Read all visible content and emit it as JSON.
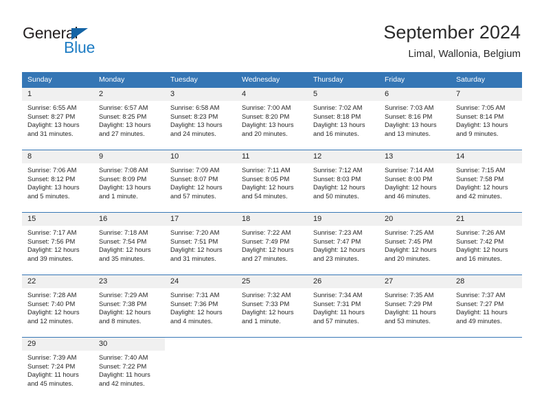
{
  "logo": {
    "word_one": "General",
    "word_two": "Blue",
    "triangle_color": "#1464a5",
    "blue_color": "#1f7dc4"
  },
  "header": {
    "title": "September 2024",
    "subtitle": "Limal, Wallonia, Belgium"
  },
  "theme": {
    "header_blue": "#3576b5",
    "daynum_gray": "#f0f0f0",
    "text_color": "#262626"
  },
  "calendar": {
    "weekdays": [
      "Sunday",
      "Monday",
      "Tuesday",
      "Wednesday",
      "Thursday",
      "Friday",
      "Saturday"
    ],
    "weeks": [
      [
        {
          "day": "1",
          "sunrise": "Sunrise: 6:55 AM",
          "sunset": "Sunset: 8:27 PM",
          "daylight_1": "Daylight: 13 hours",
          "daylight_2": "and 31 minutes."
        },
        {
          "day": "2",
          "sunrise": "Sunrise: 6:57 AM",
          "sunset": "Sunset: 8:25 PM",
          "daylight_1": "Daylight: 13 hours",
          "daylight_2": "and 27 minutes."
        },
        {
          "day": "3",
          "sunrise": "Sunrise: 6:58 AM",
          "sunset": "Sunset: 8:23 PM",
          "daylight_1": "Daylight: 13 hours",
          "daylight_2": "and 24 minutes."
        },
        {
          "day": "4",
          "sunrise": "Sunrise: 7:00 AM",
          "sunset": "Sunset: 8:20 PM",
          "daylight_1": "Daylight: 13 hours",
          "daylight_2": "and 20 minutes."
        },
        {
          "day": "5",
          "sunrise": "Sunrise: 7:02 AM",
          "sunset": "Sunset: 8:18 PM",
          "daylight_1": "Daylight: 13 hours",
          "daylight_2": "and 16 minutes."
        },
        {
          "day": "6",
          "sunrise": "Sunrise: 7:03 AM",
          "sunset": "Sunset: 8:16 PM",
          "daylight_1": "Daylight: 13 hours",
          "daylight_2": "and 13 minutes."
        },
        {
          "day": "7",
          "sunrise": "Sunrise: 7:05 AM",
          "sunset": "Sunset: 8:14 PM",
          "daylight_1": "Daylight: 13 hours",
          "daylight_2": "and 9 minutes."
        }
      ],
      [
        {
          "day": "8",
          "sunrise": "Sunrise: 7:06 AM",
          "sunset": "Sunset: 8:12 PM",
          "daylight_1": "Daylight: 13 hours",
          "daylight_2": "and 5 minutes."
        },
        {
          "day": "9",
          "sunrise": "Sunrise: 7:08 AM",
          "sunset": "Sunset: 8:09 PM",
          "daylight_1": "Daylight: 13 hours",
          "daylight_2": "and 1 minute."
        },
        {
          "day": "10",
          "sunrise": "Sunrise: 7:09 AM",
          "sunset": "Sunset: 8:07 PM",
          "daylight_1": "Daylight: 12 hours",
          "daylight_2": "and 57 minutes."
        },
        {
          "day": "11",
          "sunrise": "Sunrise: 7:11 AM",
          "sunset": "Sunset: 8:05 PM",
          "daylight_1": "Daylight: 12 hours",
          "daylight_2": "and 54 minutes."
        },
        {
          "day": "12",
          "sunrise": "Sunrise: 7:12 AM",
          "sunset": "Sunset: 8:03 PM",
          "daylight_1": "Daylight: 12 hours",
          "daylight_2": "and 50 minutes."
        },
        {
          "day": "13",
          "sunrise": "Sunrise: 7:14 AM",
          "sunset": "Sunset: 8:00 PM",
          "daylight_1": "Daylight: 12 hours",
          "daylight_2": "and 46 minutes."
        },
        {
          "day": "14",
          "sunrise": "Sunrise: 7:15 AM",
          "sunset": "Sunset: 7:58 PM",
          "daylight_1": "Daylight: 12 hours",
          "daylight_2": "and 42 minutes."
        }
      ],
      [
        {
          "day": "15",
          "sunrise": "Sunrise: 7:17 AM",
          "sunset": "Sunset: 7:56 PM",
          "daylight_1": "Daylight: 12 hours",
          "daylight_2": "and 39 minutes."
        },
        {
          "day": "16",
          "sunrise": "Sunrise: 7:18 AM",
          "sunset": "Sunset: 7:54 PM",
          "daylight_1": "Daylight: 12 hours",
          "daylight_2": "and 35 minutes."
        },
        {
          "day": "17",
          "sunrise": "Sunrise: 7:20 AM",
          "sunset": "Sunset: 7:51 PM",
          "daylight_1": "Daylight: 12 hours",
          "daylight_2": "and 31 minutes."
        },
        {
          "day": "18",
          "sunrise": "Sunrise: 7:22 AM",
          "sunset": "Sunset: 7:49 PM",
          "daylight_1": "Daylight: 12 hours",
          "daylight_2": "and 27 minutes."
        },
        {
          "day": "19",
          "sunrise": "Sunrise: 7:23 AM",
          "sunset": "Sunset: 7:47 PM",
          "daylight_1": "Daylight: 12 hours",
          "daylight_2": "and 23 minutes."
        },
        {
          "day": "20",
          "sunrise": "Sunrise: 7:25 AM",
          "sunset": "Sunset: 7:45 PM",
          "daylight_1": "Daylight: 12 hours",
          "daylight_2": "and 20 minutes."
        },
        {
          "day": "21",
          "sunrise": "Sunrise: 7:26 AM",
          "sunset": "Sunset: 7:42 PM",
          "daylight_1": "Daylight: 12 hours",
          "daylight_2": "and 16 minutes."
        }
      ],
      [
        {
          "day": "22",
          "sunrise": "Sunrise: 7:28 AM",
          "sunset": "Sunset: 7:40 PM",
          "daylight_1": "Daylight: 12 hours",
          "daylight_2": "and 12 minutes."
        },
        {
          "day": "23",
          "sunrise": "Sunrise: 7:29 AM",
          "sunset": "Sunset: 7:38 PM",
          "daylight_1": "Daylight: 12 hours",
          "daylight_2": "and 8 minutes."
        },
        {
          "day": "24",
          "sunrise": "Sunrise: 7:31 AM",
          "sunset": "Sunset: 7:36 PM",
          "daylight_1": "Daylight: 12 hours",
          "daylight_2": "and 4 minutes."
        },
        {
          "day": "25",
          "sunrise": "Sunrise: 7:32 AM",
          "sunset": "Sunset: 7:33 PM",
          "daylight_1": "Daylight: 12 hours",
          "daylight_2": "and 1 minute."
        },
        {
          "day": "26",
          "sunrise": "Sunrise: 7:34 AM",
          "sunset": "Sunset: 7:31 PM",
          "daylight_1": "Daylight: 11 hours",
          "daylight_2": "and 57 minutes."
        },
        {
          "day": "27",
          "sunrise": "Sunrise: 7:35 AM",
          "sunset": "Sunset: 7:29 PM",
          "daylight_1": "Daylight: 11 hours",
          "daylight_2": "and 53 minutes."
        },
        {
          "day": "28",
          "sunrise": "Sunrise: 7:37 AM",
          "sunset": "Sunset: 7:27 PM",
          "daylight_1": "Daylight: 11 hours",
          "daylight_2": "and 49 minutes."
        }
      ],
      [
        {
          "day": "29",
          "sunrise": "Sunrise: 7:39 AM",
          "sunset": "Sunset: 7:24 PM",
          "daylight_1": "Daylight: 11 hours",
          "daylight_2": "and 45 minutes."
        },
        {
          "day": "30",
          "sunrise": "Sunrise: 7:40 AM",
          "sunset": "Sunset: 7:22 PM",
          "daylight_1": "Daylight: 11 hours",
          "daylight_2": "and 42 minutes."
        },
        {
          "day": "",
          "sunrise": "",
          "sunset": "",
          "daylight_1": "",
          "daylight_2": ""
        },
        {
          "day": "",
          "sunrise": "",
          "sunset": "",
          "daylight_1": "",
          "daylight_2": ""
        },
        {
          "day": "",
          "sunrise": "",
          "sunset": "",
          "daylight_1": "",
          "daylight_2": ""
        },
        {
          "day": "",
          "sunrise": "",
          "sunset": "",
          "daylight_1": "",
          "daylight_2": ""
        },
        {
          "day": "",
          "sunrise": "",
          "sunset": "",
          "daylight_1": "",
          "daylight_2": ""
        }
      ]
    ]
  }
}
